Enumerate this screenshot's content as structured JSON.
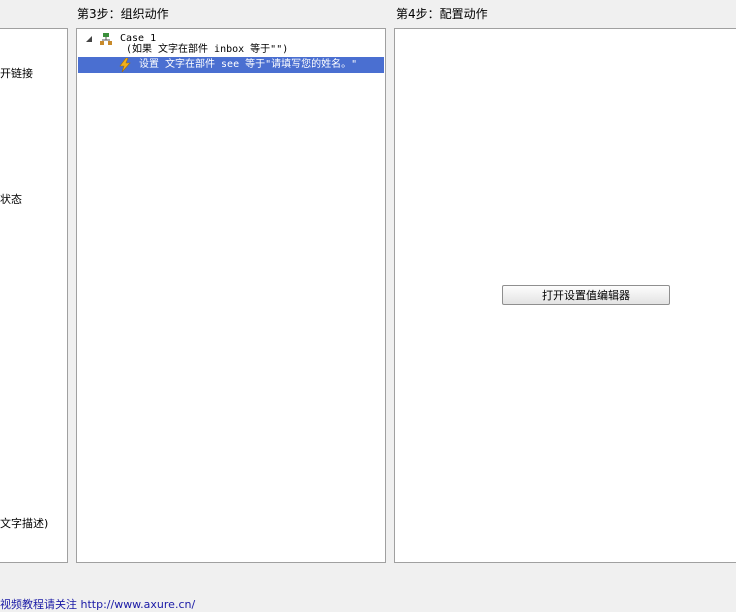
{
  "step3": {
    "title": "第3步：组织动作"
  },
  "step4": {
    "title": "第4步：配置动作"
  },
  "left_panel": {
    "items": [
      "开链接",
      "状态",
      "文字描述)"
    ]
  },
  "tree": {
    "case_label": "Case 1",
    "condition": "(如果 文字在部件 inbox 等于\"\")",
    "action": "设置 文字在部件 see 等于\"请填写您的姓名。\""
  },
  "config": {
    "button_label": "打开设置值编辑器"
  },
  "footer": {
    "link_text": "视频教程请关注 http://www.axure.cn/"
  },
  "colors": {
    "selected_row": "#4a6fd1",
    "case_icon": "#3a8f3a",
    "bolt_icon": "#f2b01e"
  }
}
